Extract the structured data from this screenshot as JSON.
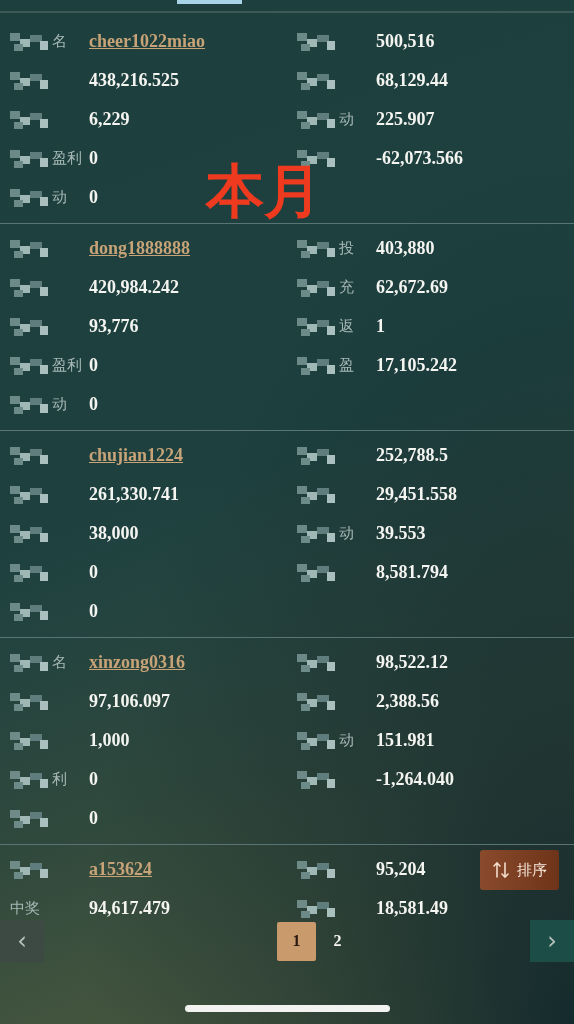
{
  "overlay_caption": "本月",
  "records": [
    {
      "left": [
        {
          "label": "名",
          "masked": true,
          "value": "cheer1022miao",
          "link": true
        },
        {
          "masked": true,
          "value": "438,216.525",
          "link": false
        },
        {
          "masked": true,
          "value": "6,229",
          "link": false
        },
        {
          "label": "盈利",
          "masked": true,
          "value": "0",
          "link": false
        },
        {
          "label": "动",
          "masked": true,
          "value": "0",
          "link": false
        }
      ],
      "right": [
        {
          "masked": true,
          "value": "500,516",
          "link": false
        },
        {
          "masked": true,
          "value": "68,129.44",
          "link": false
        },
        {
          "label": "动",
          "masked": true,
          "value": "225.907",
          "link": false
        },
        {
          "masked": true,
          "value": "-62,073.566",
          "link": false
        }
      ]
    },
    {
      "left": [
        {
          "masked": true,
          "value": "dong1888888",
          "link": true
        },
        {
          "masked": true,
          "value": "420,984.242",
          "link": false
        },
        {
          "masked": true,
          "value": "93,776",
          "link": false
        },
        {
          "label": "盈利",
          "masked": true,
          "value": "0",
          "link": false
        },
        {
          "label": "动",
          "masked": true,
          "value": "0",
          "link": false
        }
      ],
      "right": [
        {
          "label": "投",
          "masked": true,
          "value": "403,880",
          "link": false
        },
        {
          "label": "充",
          "masked": true,
          "value": "62,672.69",
          "link": false
        },
        {
          "label": "返",
          "masked": true,
          "value": "1",
          "link": false
        },
        {
          "label": "盈",
          "masked": true,
          "value": "17,105.242",
          "link": false
        }
      ]
    },
    {
      "left": [
        {
          "masked": true,
          "value": "chujian1224",
          "link": true
        },
        {
          "masked": true,
          "value": "261,330.741",
          "link": false
        },
        {
          "masked": true,
          "value": "38,000",
          "link": false
        },
        {
          "masked": true,
          "value": "0",
          "link": false
        },
        {
          "masked": true,
          "value": "0",
          "link": false
        }
      ],
      "right": [
        {
          "masked": true,
          "value": "252,788.5",
          "link": false
        },
        {
          "masked": true,
          "value": "29,451.558",
          "link": false
        },
        {
          "label": "动",
          "masked": true,
          "value": "39.553",
          "link": false
        },
        {
          "masked": true,
          "value": "8,581.794",
          "link": false
        }
      ]
    },
    {
      "left": [
        {
          "label": "名",
          "masked": true,
          "value": "xinzong0316",
          "link": true
        },
        {
          "masked": true,
          "value": "97,106.097",
          "link": false
        },
        {
          "masked": true,
          "value": "1,000",
          "link": false
        },
        {
          "label": "利",
          "masked": true,
          "value": "0",
          "link": false
        },
        {
          "masked": true,
          "value": "0",
          "link": false
        }
      ],
      "right": [
        {
          "masked": true,
          "value": "98,522.12",
          "link": false
        },
        {
          "masked": true,
          "value": "2,388.56",
          "link": false
        },
        {
          "label": "动",
          "masked": true,
          "value": "151.981",
          "link": false
        },
        {
          "masked": true,
          "value": "-1,264.040",
          "link": false
        }
      ]
    },
    {
      "left": [
        {
          "masked": true,
          "value": "a153624",
          "link": true
        },
        {
          "label": "中奖",
          "masked": false,
          "value": "94,617.479",
          "link": false
        }
      ],
      "right": [
        {
          "masked": true,
          "value": "95,204",
          "link": false
        },
        {
          "masked": true,
          "value": "18,581.49",
          "link": false
        }
      ]
    }
  ],
  "sort_button": {
    "label": "排序"
  },
  "pagination": {
    "prev": "‹",
    "next": "›",
    "pages": [
      {
        "label": "1",
        "selected": true
      },
      {
        "label": "2",
        "selected": false
      }
    ]
  }
}
